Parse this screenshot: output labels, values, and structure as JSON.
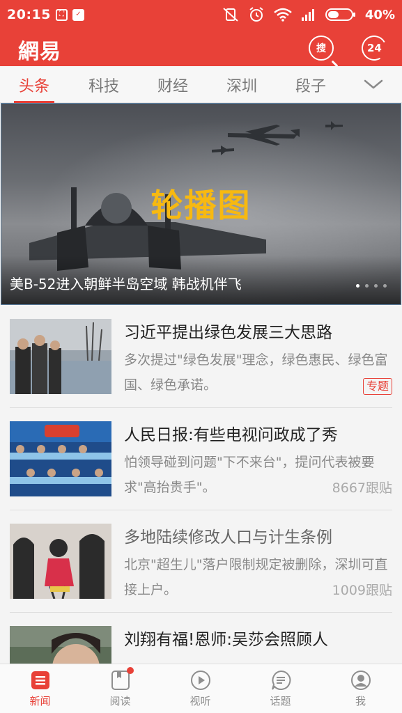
{
  "status_bar": {
    "time": "20:15",
    "battery": "40%"
  },
  "app": {
    "logo": "網易",
    "search_label": "搜",
    "live_label": "24"
  },
  "tabs": [
    {
      "label": "头条",
      "active": true
    },
    {
      "label": "科技"
    },
    {
      "label": "财经"
    },
    {
      "label": "深圳"
    },
    {
      "label": "段子"
    }
  ],
  "carousel": {
    "overlay_title": "轮播图",
    "caption": "美B-52进入朝鲜半岛空域 韩战机伴飞",
    "dots": 4,
    "active_dot": 1
  },
  "news": [
    {
      "title": "习近平提出绿色发展三大思路",
      "desc": "多次提过\"绿色发展\"理念，绿色惠民、绿色富国、绿色承诺。",
      "badge": "专题",
      "meta": ""
    },
    {
      "title": "人民日报:有些电视问政成了秀",
      "desc": "怕领导碰到问题\"下不来台\"，提问代表被要求\"高抬贵手\"。",
      "badge": "",
      "meta": "8667跟贴"
    },
    {
      "title": "多地陆续修改人口与计生条例",
      "desc": "北京\"超生儿\"落户限制规定被删除，深圳可直接上户。",
      "badge": "",
      "meta": "1009跟贴"
    },
    {
      "title": "刘翔有福!恩师:吴莎会照顾人",
      "desc": "",
      "badge": "",
      "meta": ""
    }
  ],
  "bottom_nav": [
    {
      "label": "新闻",
      "icon": "news-icon",
      "active": true
    },
    {
      "label": "阅读",
      "icon": "reading-icon",
      "badge_dot": true
    },
    {
      "label": "视听",
      "icon": "play-icon"
    },
    {
      "label": "话题",
      "icon": "topic-icon"
    },
    {
      "label": "我",
      "icon": "profile-icon"
    }
  ],
  "colors": {
    "brand": "#e84138",
    "carousel_title": "#f7b911"
  }
}
